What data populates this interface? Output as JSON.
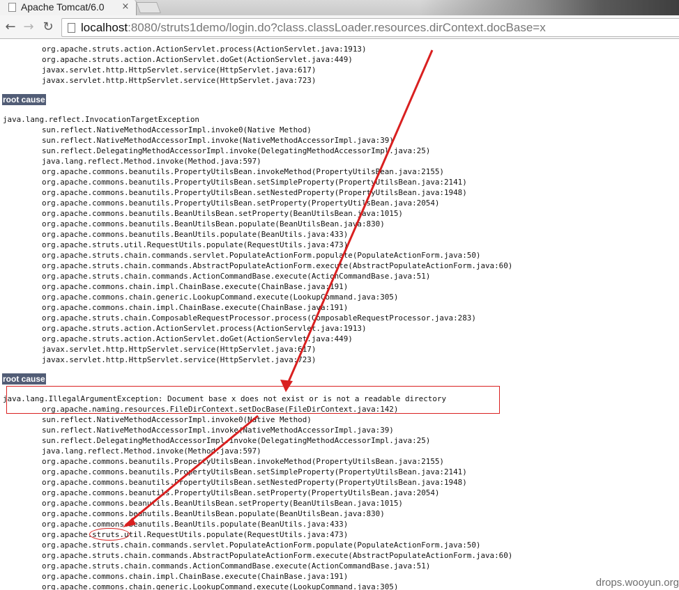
{
  "browser": {
    "tab_title": "Apache Tomcat/6.0",
    "tab_close": "×",
    "url_scheme_host": "localhost",
    "url_rest": ":8080/struts1demo/login.do?class.classLoader.resources.dirContext.docBase=x",
    "back_icon": "back-arrow-icon",
    "forward_icon": "forward-arrow-icon",
    "reload_icon": "reload-icon"
  },
  "page": {
    "top_lines": [
      "org.apache.struts.action.ActionServlet.process(ActionServlet.java:1913)",
      "org.apache.struts.action.ActionServlet.doGet(ActionServlet.java:449)",
      "javax.servlet.http.HttpServlet.service(HttpServlet.java:617)",
      "javax.servlet.http.HttpServlet.service(HttpServlet.java:723)"
    ],
    "root_cause_label": "root cause",
    "cause1_header": "java.lang.reflect.InvocationTargetException",
    "cause1_lines": [
      "sun.reflect.NativeMethodAccessorImpl.invoke0(Native Method)",
      "sun.reflect.NativeMethodAccessorImpl.invoke(NativeMethodAccessorImpl.java:39)",
      "sun.reflect.DelegatingMethodAccessorImpl.invoke(DelegatingMethodAccessorImpl.java:25)",
      "java.lang.reflect.Method.invoke(Method.java:597)",
      "org.apache.commons.beanutils.PropertyUtilsBean.invokeMethod(PropertyUtilsBean.java:2155)",
      "org.apache.commons.beanutils.PropertyUtilsBean.setSimpleProperty(PropertyUtilsBean.java:2141)",
      "org.apache.commons.beanutils.PropertyUtilsBean.setNestedProperty(PropertyUtilsBean.java:1948)",
      "org.apache.commons.beanutils.PropertyUtilsBean.setProperty(PropertyUtilsBean.java:2054)",
      "org.apache.commons.beanutils.BeanUtilsBean.setProperty(BeanUtilsBean.java:1015)",
      "org.apache.commons.beanutils.BeanUtilsBean.populate(BeanUtilsBean.java:830)",
      "org.apache.commons.beanutils.BeanUtils.populate(BeanUtils.java:433)",
      "org.apache.struts.util.RequestUtils.populate(RequestUtils.java:473)",
      "org.apache.struts.chain.commands.servlet.PopulateActionForm.populate(PopulateActionForm.java:50)",
      "org.apache.struts.chain.commands.AbstractPopulateActionForm.execute(AbstractPopulateActionForm.java:60)",
      "org.apache.struts.chain.commands.ActionCommandBase.execute(ActionCommandBase.java:51)",
      "org.apache.commons.chain.impl.ChainBase.execute(ChainBase.java:191)",
      "org.apache.commons.chain.generic.LookupCommand.execute(LookupCommand.java:305)",
      "org.apache.commons.chain.impl.ChainBase.execute(ChainBase.java:191)",
      "org.apache.struts.chain.ComposableRequestProcessor.process(ComposableRequestProcessor.java:283)",
      "org.apache.struts.action.ActionServlet.process(ActionServlet.java:1913)",
      "org.apache.struts.action.ActionServlet.doGet(ActionServlet.java:449)",
      "javax.servlet.http.HttpServlet.service(HttpServlet.java:617)",
      "javax.servlet.http.HttpServlet.service(HttpServlet.java:723)"
    ],
    "cause2_header": "java.lang.IllegalArgumentException: Document base x does not exist or is not a readable directory",
    "cause2_lines": [
      "org.apache.naming.resources.FileDirContext.setDocBase(FileDirContext.java:142)",
      "sun.reflect.NativeMethodAccessorImpl.invoke0(Native Method)",
      "sun.reflect.NativeMethodAccessorImpl.invoke(NativeMethodAccessorImpl.java:39)",
      "sun.reflect.DelegatingMethodAccessorImpl.invoke(DelegatingMethodAccessorImpl.java:25)",
      "java.lang.reflect.Method.invoke(Method.java:597)",
      "org.apache.commons.beanutils.PropertyUtilsBean.invokeMethod(PropertyUtilsBean.java:2155)",
      "org.apache.commons.beanutils.PropertyUtilsBean.setSimpleProperty(PropertyUtilsBean.java:2141)",
      "org.apache.commons.beanutils.PropertyUtilsBean.setNestedProperty(PropertyUtilsBean.java:1948)",
      "org.apache.commons.beanutils.PropertyUtilsBean.setProperty(PropertyUtilsBean.java:2054)",
      "org.apache.commons.beanutils.BeanUtilsBean.setProperty(BeanUtilsBean.java:1015)",
      "org.apache.commons.beanutils.BeanUtilsBean.populate(BeanUtilsBean.java:830)",
      "org.apache.commons.beanutils.BeanUtils.populate(BeanUtils.java:433)",
      "org.apache.struts.util.RequestUtils.populate(RequestUtils.java:473)",
      "org.apache.struts.chain.commands.servlet.PopulateActionForm.populate(PopulateActionForm.java:50)",
      "org.apache.struts.chain.commands.AbstractPopulateActionForm.execute(AbstractPopulateActionForm.java:60)",
      "org.apache.struts.chain.commands.ActionCommandBase.execute(ActionCommandBase.java:51)",
      "org.apache.commons.chain.impl.ChainBase.execute(ChainBase.java:191)",
      "org.apache.commons.chain.generic.LookupCommand.execute(LookupCommand.java:305)"
    ],
    "watermark": "drops.wooyun.org"
  },
  "colors": {
    "root_cause_bg": "#525d76",
    "annotation_red": "#d92020"
  }
}
